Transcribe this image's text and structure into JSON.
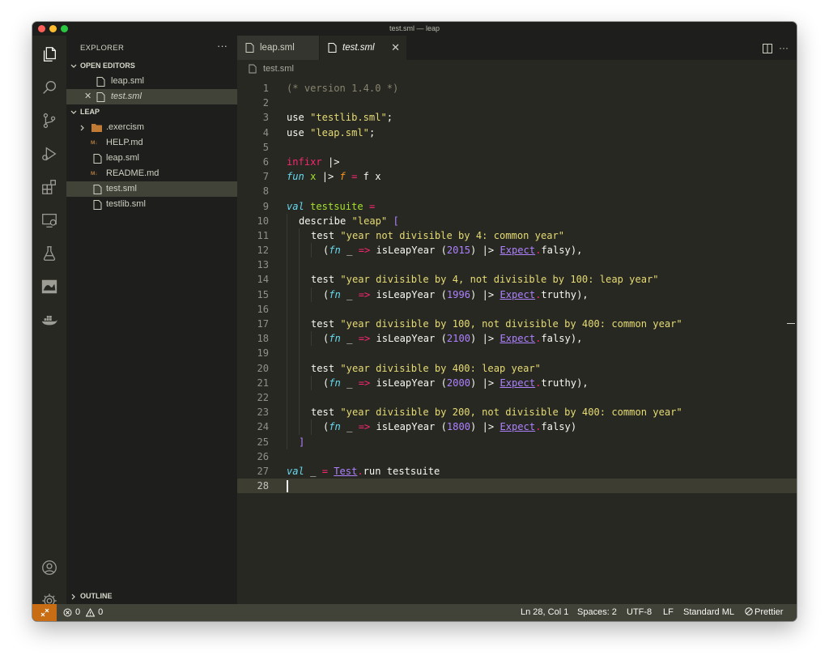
{
  "window": {
    "title": "test.sml — leap"
  },
  "explorer": {
    "title": "EXPLORER",
    "more": "···",
    "open_editors_label": "OPEN EDITORS",
    "open_editors": [
      {
        "name": "leap.sml"
      },
      {
        "name": "test.sml",
        "close": "✕"
      }
    ],
    "folder_label": "LEAP",
    "files": [
      {
        "name": ".exercism",
        "type": "folder"
      },
      {
        "name": "HELP.md",
        "type": "markdown",
        "badge": "M↓"
      },
      {
        "name": "leap.sml",
        "type": "file"
      },
      {
        "name": "README.md",
        "type": "markdown",
        "badge": "M↓"
      },
      {
        "name": "test.sml",
        "type": "file"
      },
      {
        "name": "testlib.sml",
        "type": "file"
      }
    ],
    "outline_label": "OUTLINE"
  },
  "tabs": [
    {
      "label": "leap.sml"
    },
    {
      "label": "test.sml",
      "close": "✕"
    }
  ],
  "breadcrumb": "test.sml",
  "editor_actions": {
    "more": "···"
  },
  "code": {
    "line_numbers": [
      "1",
      "2",
      "3",
      "4",
      "5",
      "6",
      "7",
      "8",
      "9",
      "10",
      "11",
      "12",
      "13",
      "14",
      "15",
      "16",
      "17",
      "18",
      "19",
      "20",
      "21",
      "22",
      "23",
      "24",
      "25",
      "26",
      "27",
      "28"
    ],
    "current_line": 28,
    "tokens": {
      "l1": "(* version 1.4.0 *)",
      "l3_use": "use ",
      "l3_str": "\"testlib.sml\"",
      "l3_end": ";",
      "l4_use": "use ",
      "l4_str": "\"leap.sml\"",
      "l4_end": ";",
      "l6_kw": "infixr",
      "l6_op": " |>",
      "l7_fun": "fun",
      "l7_x": " x ",
      "l7_op": "|>",
      "l7_f": " f ",
      "l7_eq": "=",
      "l7_rest": " f x",
      "l9_val": "val",
      "l9_name": " testsuite ",
      "l9_eq": "=",
      "l10_fn": "describe ",
      "l10_str": "\"leap\"",
      "l10_br": " [",
      "test": "test ",
      "fn": "fn",
      "us": " _ ",
      "arrow": "=>",
      "isleap": " isLeapYear ",
      "pipe": " |> ",
      "expect": "Expect",
      "dot": ".",
      "falsy": "falsy",
      "truthy": "truthy",
      "t11": "\"year not divisible by 4: common year\"",
      "y12": "2015",
      "t14": "\"year divisible by 4, not divisible by 100: leap year\"",
      "y15": "1996",
      "t17": "\"year divisible by 100, not divisible by 400: common year\"",
      "y18": "2100",
      "t20": "\"year divisible by 400: leap year\"",
      "y21": "2000",
      "t23": "\"year divisible by 200, not divisible by 400: common year\"",
      "y24": "1800",
      "l25": "]",
      "l27_val": "val",
      "l27_us": " _ ",
      "l27_eq": "=",
      "l27_mod": "Test",
      "l27_dot": ".",
      "l27_rest": "run testsuite"
    }
  },
  "statusbar": {
    "problems": "0",
    "warnings": "0",
    "position": "Ln 28, Col 1",
    "spaces": "Spaces: 2",
    "encoding": "UTF-8",
    "eol": "LF",
    "language": "Standard ML",
    "formatter": "Prettier"
  },
  "colors": {
    "background": "#272822",
    "sidebar": "#1e1f1c",
    "statusbar": "#414339",
    "remote": "#c96d14",
    "keyword": "#f92672",
    "string": "#e6db74",
    "function": "#a6e22e",
    "number": "#ae81ff",
    "storage": "#66d9ef",
    "comment": "#88846f"
  },
  "icons": {
    "activity": [
      "files-icon",
      "search-icon",
      "source-control-icon",
      "run-debug-icon",
      "extensions-icon",
      "remote-explorer-icon",
      "testing-icon",
      "camel-icon",
      "docker-icon",
      "account-icon",
      "settings-gear-icon"
    ]
  }
}
